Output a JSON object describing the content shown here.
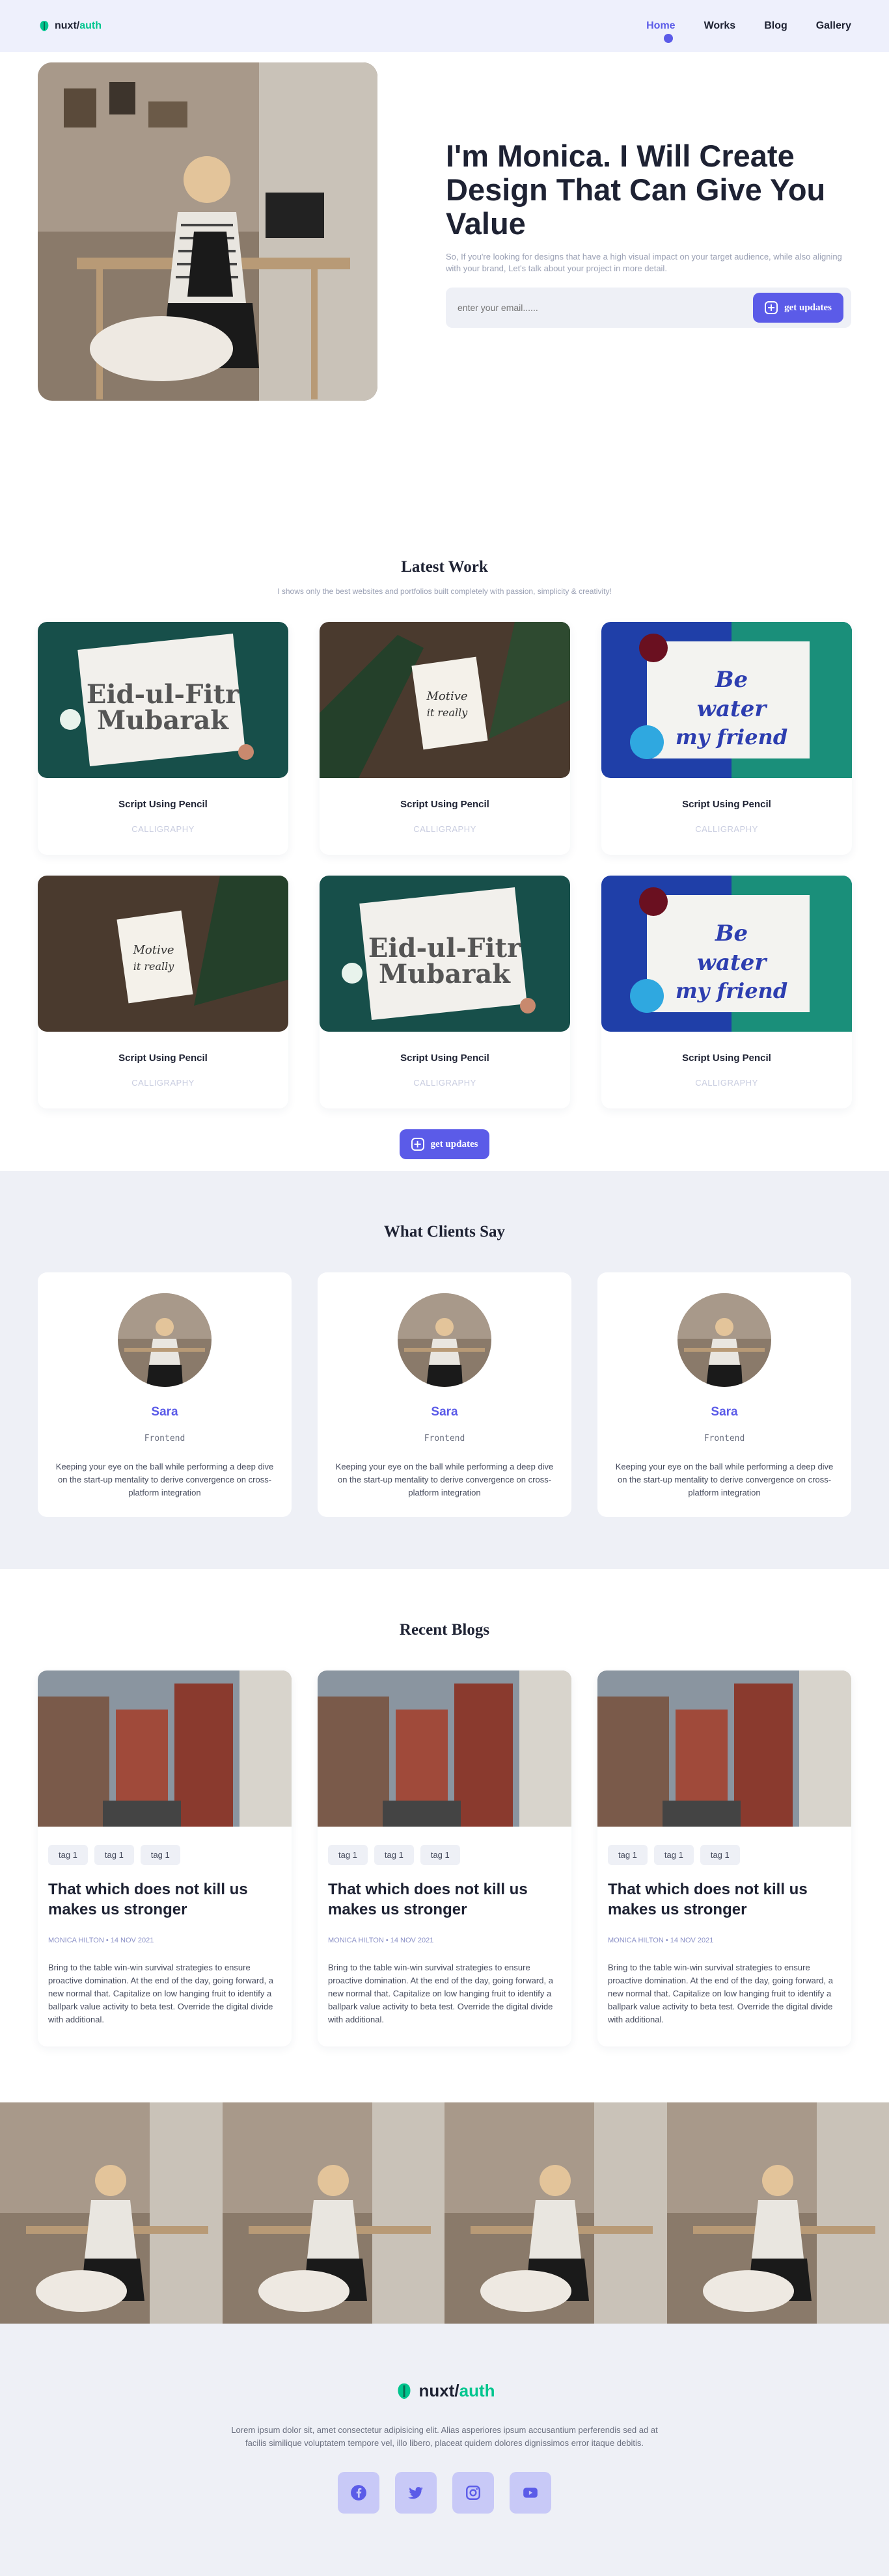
{
  "nav": {
    "logo_prefix": "nuxt/",
    "logo_suffix": "auth",
    "links": [
      "Home",
      "Works",
      "Blog",
      "Gallery"
    ]
  },
  "hero": {
    "title": "I'm Monica. I Will Create Design That Can Give You Value",
    "text": "So, If you're looking for designs that have a high visual impact on your target audience, while also aligning with your brand, Let's talk about your project in more detail.",
    "email_placeholder": "enter your email......",
    "button_label": "get updates"
  },
  "work": {
    "title": "Latest Work",
    "subtitle": "I shows only the best websites and portfolios built completely with passion, simplicity & creativity!",
    "items": [
      {
        "title": "Script Using Pencil",
        "category": "CALLIGRAPHY"
      },
      {
        "title": "Script Using Pencil",
        "category": "CALLIGRAPHY"
      },
      {
        "title": "Script Using Pencil",
        "category": "CALLIGRAPHY"
      },
      {
        "title": "Script Using Pencil",
        "category": "CALLIGRAPHY"
      },
      {
        "title": "Script Using Pencil",
        "category": "CALLIGRAPHY"
      },
      {
        "title": "Script Using Pencil",
        "category": "CALLIGRAPHY"
      }
    ],
    "button_label": "get updates"
  },
  "clients": {
    "title": "What Clients Say",
    "items": [
      {
        "name": "Sara",
        "role": "Frontend",
        "quote": "Keeping your eye on the ball while performing a deep dive on the start-up mentality to derive convergence on cross-platform integration"
      },
      {
        "name": "Sara",
        "role": "Frontend",
        "quote": "Keeping your eye on the ball while performing a deep dive on the start-up mentality to derive convergence on cross-platform integration"
      },
      {
        "name": "Sara",
        "role": "Frontend",
        "quote": "Keeping your eye on the ball while performing a deep dive on the start-up mentality to derive convergence on cross-platform integration"
      }
    ]
  },
  "blogs": {
    "title": "Recent Blogs",
    "items": [
      {
        "tags": [
          "tag 1",
          "tag 1",
          "tag 1"
        ],
        "title": "That which does not kill us makes us stronger",
        "meta": "MONICA HILTON • 14 NOV 2021",
        "excerpt": "Bring to the table win-win survival strategies to ensure proactive domination. At the end of the day, going forward, a new normal that. Capitalize on low hanging fruit to identify a ballpark value activity to beta test. Override the digital divide with additional."
      },
      {
        "tags": [
          "tag 1",
          "tag 1",
          "tag 1"
        ],
        "title": "That which does not kill us makes us stronger",
        "meta": "MONICA HILTON • 14 NOV 2021",
        "excerpt": "Bring to the table win-win survival strategies to ensure proactive domination. At the end of the day, going forward, a new normal that. Capitalize on low hanging fruit to identify a ballpark value activity to beta test. Override the digital divide with additional."
      },
      {
        "tags": [
          "tag 1",
          "tag 1",
          "tag 1"
        ],
        "title": "That which does not kill us makes us stronger",
        "meta": "MONICA HILTON • 14 NOV 2021",
        "excerpt": "Bring to the table win-win survival strategies to ensure proactive domination. At the end of the day, going forward, a new normal that. Capitalize on low hanging fruit to identify a ballpark value activity to beta test. Override the digital divide with additional."
      }
    ]
  },
  "footer": {
    "logo_prefix": "nuxt/",
    "logo_suffix": "auth",
    "text": "Lorem ipsum dolor sit, amet consectetur adipisicing elit. Alias asperiores ipsum accusantium perferendis sed ad at facilis similique voluptatem tempore vel, illo libero, placeat quidem dolores dignissimos error itaque debitis.",
    "socials": [
      "facebook-icon",
      "twitter-icon",
      "instagram-icon",
      "youtube-icon"
    ]
  },
  "colors": {
    "accent": "#5b5be8",
    "brand": "#00c58e",
    "soft_bg": "#eef0f6"
  }
}
